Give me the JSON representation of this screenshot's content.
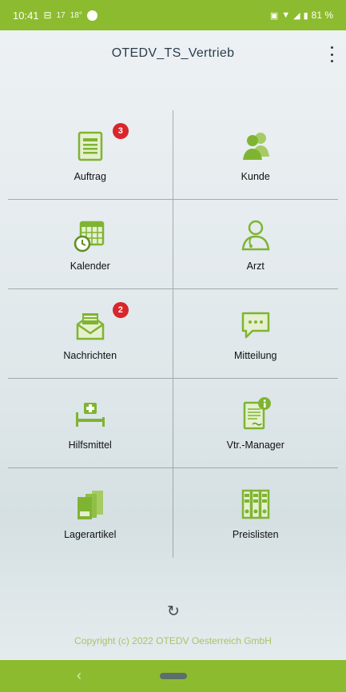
{
  "status_bar": {
    "time": "10:41",
    "extra1": "17",
    "extra2": "18°",
    "battery": "81 %"
  },
  "app_bar": {
    "title": "OTEDV_TS_Vertrieb"
  },
  "tiles": [
    {
      "label": "Auftrag",
      "icon": "order-form-icon",
      "badge": "3"
    },
    {
      "label": "Kunde",
      "icon": "customer-icon"
    },
    {
      "label": "Kalender",
      "icon": "calendar-clock-icon"
    },
    {
      "label": "Arzt",
      "icon": "doctor-icon"
    },
    {
      "label": "Nachrichten",
      "icon": "mail-open-icon",
      "badge": "2"
    },
    {
      "label": "Mitteilung",
      "icon": "chat-bubble-icon"
    },
    {
      "label": "Hilfsmittel",
      "icon": "hospital-bed-icon"
    },
    {
      "label": "Vtr.-Manager",
      "icon": "document-info-icon"
    },
    {
      "label": "Lagerartikel",
      "icon": "storage-boxes-icon"
    },
    {
      "label": "Preislisten",
      "icon": "binders-icon"
    }
  ],
  "footer": {
    "copyright": "Copyright (c) 2022 OTEDV Oesterreich GmbH"
  },
  "colors": {
    "accent": "#8dbb2f",
    "icon_green": "#7fb432",
    "badge": "#d8262a"
  }
}
